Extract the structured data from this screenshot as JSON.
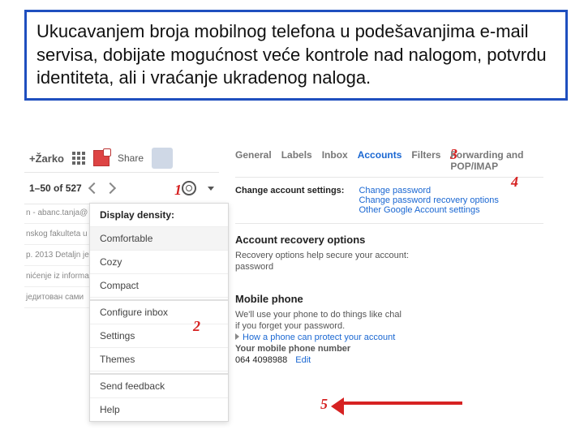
{
  "callout": "Ukucavanjem broja mobilnog telefona  u podešavanjima e-mail servisa, dobijate mogućnost veće kontrole nad nalogom, potvrdu identiteta, ali i vraćanje ukradenog naloga.",
  "topbar": {
    "user": "+Žarko",
    "share": "Share"
  },
  "pager": {
    "range": "1–50 of 527"
  },
  "gear_menu": {
    "header": "Display density:",
    "items": [
      "Comfortable",
      "Cozy",
      "Compact",
      "Configure inbox",
      "Settings",
      "Themes",
      "Send feedback",
      "Help"
    ]
  },
  "inbox_rows": [
    "n - abanc.tanja@",
    "nskog fakulteta u",
    "p. 2013 Detaljn je",
    "nićenje iz informa",
    "једитован сами"
  ],
  "tabs": [
    "General",
    "Labels",
    "Inbox",
    "Accounts",
    "Filters",
    "Forwarding and POP/IMAP"
  ],
  "change_settings": {
    "label": "Change account settings:",
    "links": [
      "Change password",
      "Change password recovery options",
      "Other Google Account settings"
    ]
  },
  "recovery": {
    "title": "Account recovery options",
    "desc": "Recovery options help secure your account:",
    "pw": "password"
  },
  "mobile": {
    "title": "Mobile phone",
    "line1": "We'll use your phone to do things like chal",
    "line2": "if you forget your password.",
    "howlink": "How a phone can protect your account",
    "yourlabel": "Your mobile phone number",
    "num": "064 4098988",
    "edit": "Edit"
  },
  "annotations": {
    "a1": "1",
    "a2": "2",
    "a3": "3",
    "a4": "4",
    "a5": "5"
  }
}
